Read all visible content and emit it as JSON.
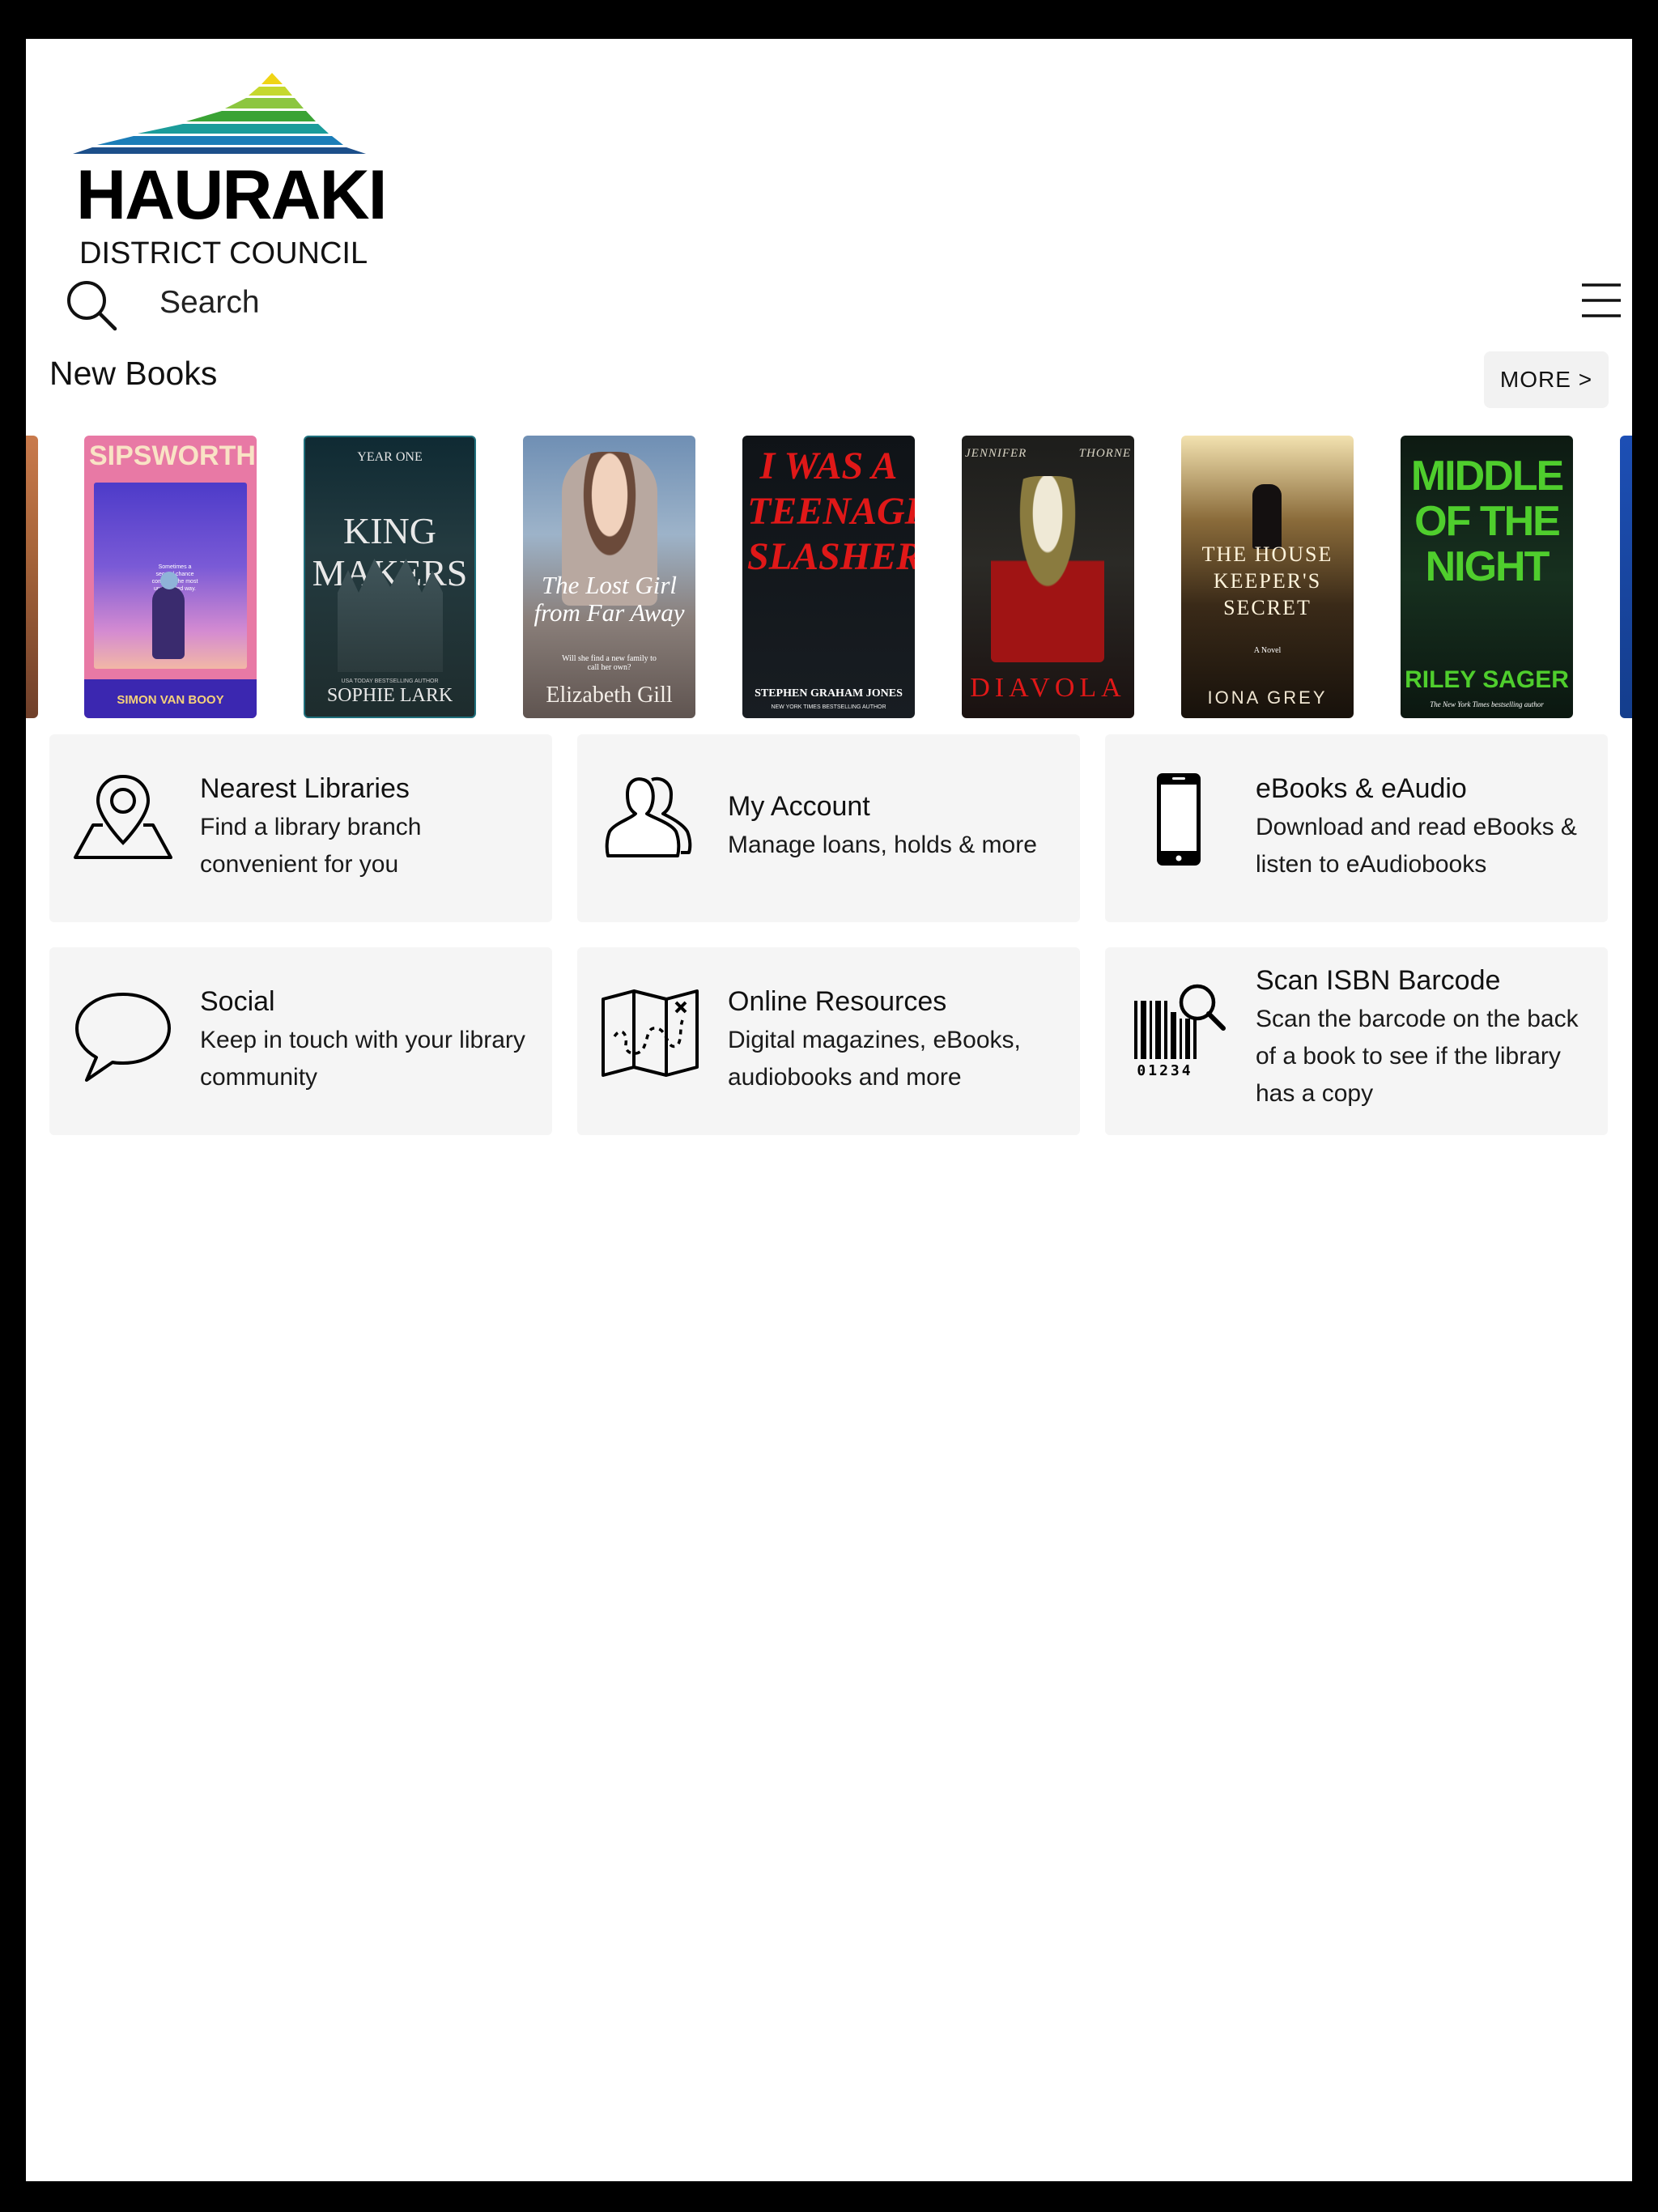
{
  "brand": {
    "name": "HAURAKI",
    "subtitle": "DISTRICT COUNCIL",
    "colors": {
      "top": "#f0d415",
      "green_light": "#8cc63f",
      "green": "#3aa335",
      "teal": "#1b9c9a",
      "blue": "#1b6fae",
      "navy": "#1c4f8a"
    }
  },
  "search": {
    "placeholder": "Search",
    "icon": "search-icon"
  },
  "menu": {
    "icon": "hamburger-menu-icon"
  },
  "new_books": {
    "title": "New Books",
    "more_label": "MORE >",
    "books": [
      {
        "title": "",
        "author": ""
      },
      {
        "title": "SIPSWORTH",
        "author": "SIMON VAN BOOY",
        "blurb": "Sometimes a second chance comes in the most unexpected way."
      },
      {
        "title": "KING MAKERS",
        "kicker": "YEAR ONE",
        "author": "SOPHIE LARK",
        "tagline": "USA TODAY BESTSELLING AUTHOR"
      },
      {
        "title": "The Lost Girl from Far Away",
        "tagline": "Will she find a new family to call her own?",
        "author": "Elizabeth Gill"
      },
      {
        "title": "I WAS A TEENAGE SLASHER",
        "author": "STEPHEN GRAHAM JONES",
        "tagline": "NEW YORK TIMES BESTSELLING AUTHOR"
      },
      {
        "title": "DIAVOLA",
        "author": "JENNIFER THORNE"
      },
      {
        "title": "THE HOUSE KEEPER'S SECRET",
        "kicker": "A Novel",
        "author": "IONA GREY"
      },
      {
        "title": "MIDDLE OF THE NIGHT",
        "author": "RILEY SAGER",
        "tagline": "The New York Times bestselling author"
      },
      {
        "title": "",
        "author": ""
      }
    ]
  },
  "tiles": [
    {
      "title": "Nearest Libraries",
      "desc": "Find a library branch convenient for you",
      "icon": "map-pin-icon"
    },
    {
      "title": "My Account",
      "desc": "Manage loans, holds & more",
      "icon": "users-icon"
    },
    {
      "title": "eBooks & eAudio",
      "desc": "Download and read eBooks & listen to eAudiobooks",
      "icon": "smartphone-icon"
    },
    {
      "title": "Social",
      "desc": "Keep in touch with your library community",
      "icon": "speech-bubble-icon"
    },
    {
      "title": "Online Resources",
      "desc": "Digital magazines, eBooks, audiobooks and more",
      "icon": "treasure-map-icon"
    },
    {
      "title": "Scan ISBN Barcode",
      "desc": "Scan the barcode on the back of a book to see if the library has a copy",
      "icon": "barcode-scan-icon",
      "barcode_digits": "01234"
    }
  ]
}
